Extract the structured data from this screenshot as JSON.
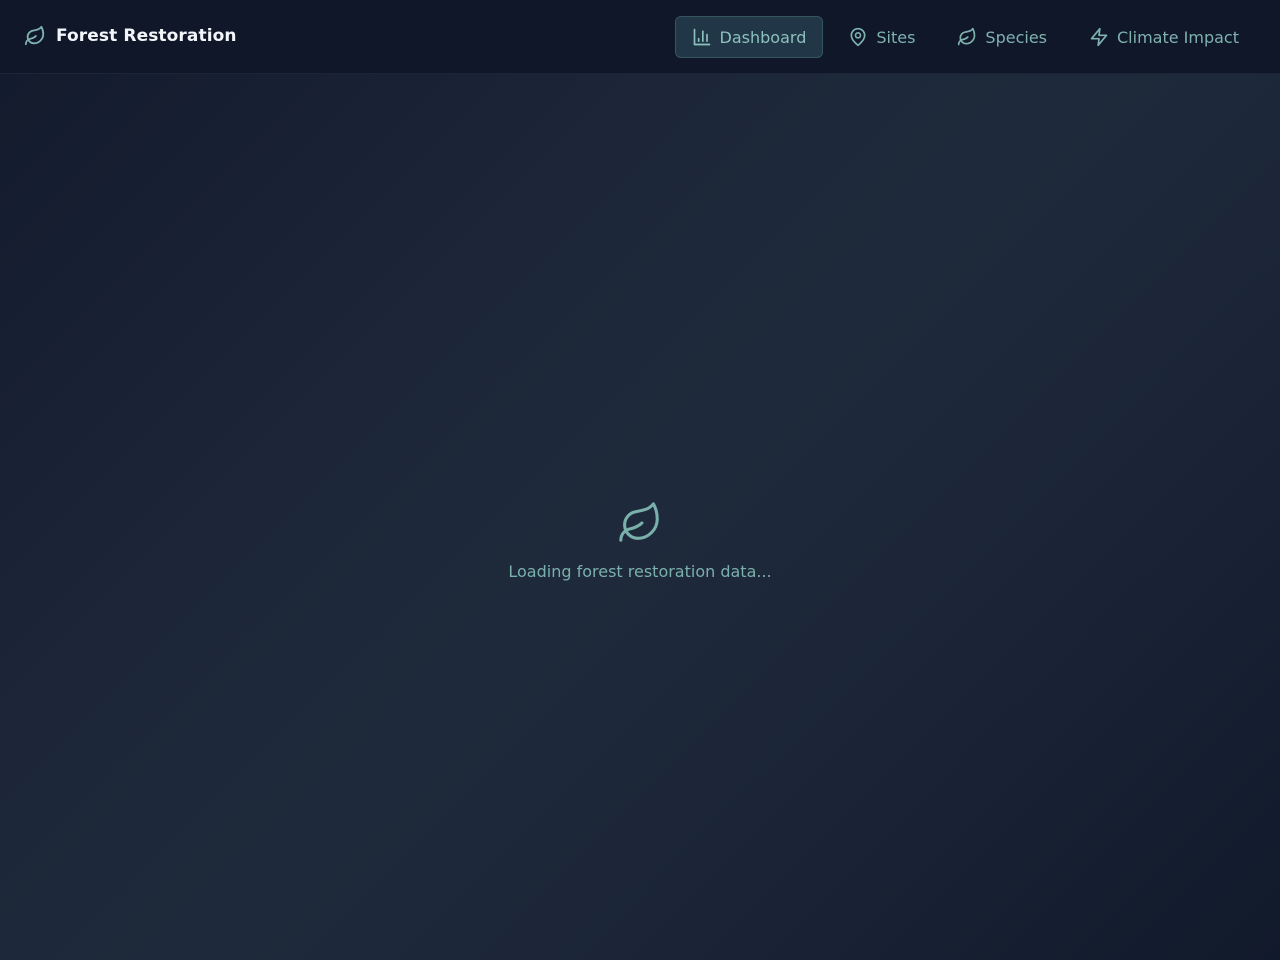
{
  "header": {
    "brand_icon": "leaf-icon",
    "title": "Forest Restoration"
  },
  "nav": {
    "items": [
      {
        "label": "Dashboard",
        "icon": "bar-chart-icon",
        "active": true
      },
      {
        "label": "Sites",
        "icon": "map-pin-icon",
        "active": false
      },
      {
        "label": "Species",
        "icon": "leaf-icon",
        "active": false
      },
      {
        "label": "Climate Impact",
        "icon": "lightning-icon",
        "active": false
      }
    ]
  },
  "loading": {
    "icon": "leaf-icon",
    "text": "Loading forest restoration data..."
  },
  "colors": {
    "accent": "#7fb2ae",
    "header_bg": "#0f1729",
    "background": "#1e2a3b",
    "active_bg": "#213646"
  }
}
